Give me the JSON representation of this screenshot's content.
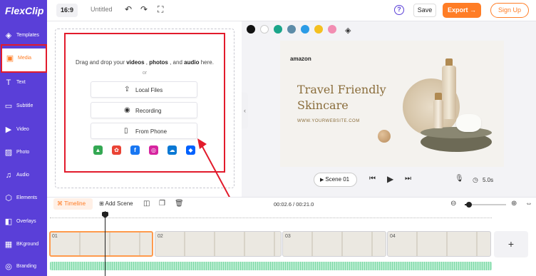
{
  "app": {
    "logo": "FlexClip",
    "ratio": "16:9",
    "project_name": "Untitled",
    "save": "Save",
    "export": "Export →",
    "signup": "Sign Up",
    "help": "?"
  },
  "sidebar": {
    "items": [
      {
        "label": "Templates",
        "icon": "templates-icon",
        "glyph": "◈"
      },
      {
        "label": "Media",
        "icon": "media-folder-icon",
        "glyph": "▣"
      },
      {
        "label": "Text",
        "icon": "text-icon",
        "glyph": "T"
      },
      {
        "label": "Subtitle",
        "icon": "subtitle-icon",
        "glyph": "▭"
      },
      {
        "label": "Video",
        "icon": "video-icon",
        "glyph": "▶"
      },
      {
        "label": "Photo",
        "icon": "photo-icon",
        "glyph": "▨"
      },
      {
        "label": "Audio",
        "icon": "audio-icon",
        "glyph": "♫"
      },
      {
        "label": "Elements",
        "icon": "elements-icon",
        "glyph": "⬡"
      },
      {
        "label": "Overlays",
        "icon": "overlays-icon",
        "glyph": "◧"
      },
      {
        "label": "BKground",
        "icon": "background-icon",
        "glyph": "▦"
      },
      {
        "label": "Branding",
        "icon": "branding-icon",
        "glyph": "◎"
      }
    ],
    "active_index": 1,
    "accent": "#ff7d26",
    "bg": "#5a3fd8"
  },
  "media_panel": {
    "drop_prefix": "Drag and drop your ",
    "drop_videos": "videos",
    "drop_sep1": " , ",
    "drop_photos": "photos",
    "drop_sep2": " , and ",
    "drop_audio": "audio",
    "drop_suffix": " here.",
    "or": "or",
    "buttons": [
      {
        "label": "Local Files",
        "icon": "upload-icon",
        "glyph": "⇪"
      },
      {
        "label": "Recording",
        "icon": "record-icon",
        "glyph": "◉"
      },
      {
        "label": "From Phone",
        "icon": "phone-icon",
        "glyph": "▯"
      }
    ],
    "cloud_sources": [
      {
        "icon": "google-drive-icon",
        "glyph": "▲",
        "color": "#34a853"
      },
      {
        "icon": "google-photos-icon",
        "glyph": "✿",
        "color": "#ea4335"
      },
      {
        "icon": "facebook-icon",
        "glyph": "f",
        "color": "#1877f2"
      },
      {
        "icon": "instagram-icon",
        "glyph": "◎",
        "color": "#d6249f"
      },
      {
        "icon": "onedrive-icon",
        "glyph": "☁",
        "color": "#0a78d4"
      },
      {
        "icon": "dropbox-icon",
        "glyph": "◆",
        "color": "#0061fe"
      }
    ]
  },
  "canvas": {
    "colors": [
      "#111111",
      "#ffffff",
      "#1aa58a",
      "#5d8ca8",
      "#2b9be6",
      "#f4c021",
      "#f28db2"
    ],
    "brand": "amazon",
    "headline_1": "Travel Friendly",
    "headline_2": "Skincare",
    "website": "WWW.YOURWEBSITE.COM"
  },
  "player": {
    "scene": "Scene 01",
    "duration": "5.0s"
  },
  "timeline": {
    "tab": "Timeline",
    "add_scene": "Add Scene",
    "time": "00:02.6 / 00:21.0",
    "zoom_level": 0.1,
    "clips": [
      "01",
      "02",
      "03",
      "04"
    ],
    "add_clip": "+"
  }
}
